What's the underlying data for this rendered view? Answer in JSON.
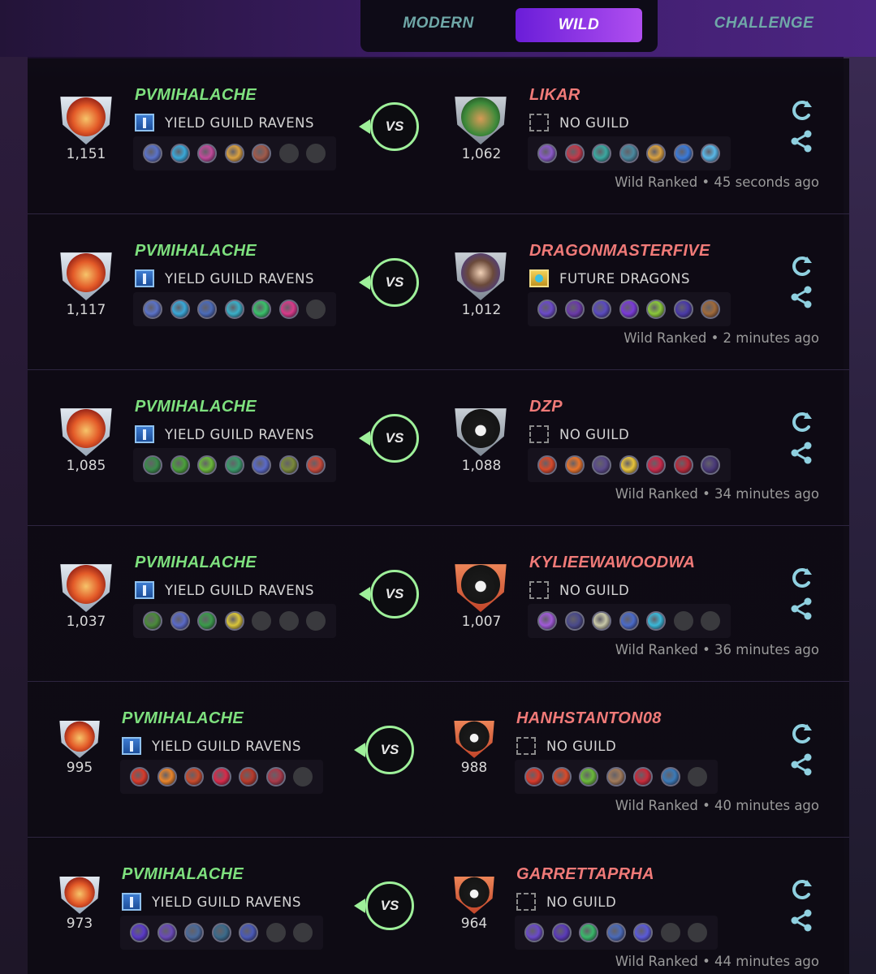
{
  "tabs": [
    {
      "label": "MODERN",
      "active": false
    },
    {
      "label": "WILD",
      "active": true
    },
    {
      "label": "CHALLENGE",
      "active": false
    }
  ],
  "vs_label": "VS",
  "colors": {
    "accent": "#9ef09a",
    "tab_active_start": "#6a1dd8",
    "tab_active_end": "#b04ff0",
    "player1_name": "#7ee07e",
    "player2_name": "#f07a78"
  },
  "matches": [
    {
      "p1": {
        "name": "PVMIHALACHE",
        "guild": "YIELD GUILD RAVENS",
        "rating": "1,151",
        "cards": [
          "#5a72c8",
          "#3aa8d8",
          "#c04a9a",
          "#d8a040",
          "#a05a4a",
          "empty",
          "empty"
        ]
      },
      "p2": {
        "name": "LIKAR",
        "guild": "NO GUILD",
        "rating": "1,062",
        "cards": [
          "#8a5ac8",
          "#c03a4a",
          "#3aa8a0",
          "#4a8aa0",
          "#d8a040",
          "#3a7ad8",
          "#5ab8e8"
        ]
      },
      "meta": "Wild Ranked • 45 seconds ago"
    },
    {
      "p1": {
        "name": "PVMIHALACHE",
        "guild": "YIELD GUILD RAVENS",
        "rating": "1,117",
        "cards": [
          "#5a72c8",
          "#3aa8d8",
          "#4a6ab8",
          "#3ab0c8",
          "#3ac06a",
          "#d83a8a",
          "empty"
        ]
      },
      "p2": {
        "name": "DRAGONMASTERFIVE",
        "guild": "FUTURE DRAGONS",
        "rating": "1,012",
        "cards": [
          "#6a4ac8",
          "#6a3aa8",
          "#5a4ac0",
          "#7a3ad8",
          "#8ac83a",
          "#4a3aa8",
          "#a06a3a"
        ]
      },
      "meta": "Wild Ranked • 2 minutes ago"
    },
    {
      "p1": {
        "name": "PVMIHALACHE",
        "guild": "YIELD GUILD RAVENS",
        "rating": "1,085",
        "cards": [
          "#3a8a4a",
          "#4aa03a",
          "#6ab83a",
          "#3a9a6a",
          "#5a6ac8",
          "#7a8a3a",
          "#c84a3a"
        ]
      },
      "p2": {
        "name": "DZP",
        "guild": "NO GUILD",
        "rating": "1,088",
        "cards": [
          "#d84a2a",
          "#e8742a",
          "#5a4a8a",
          "#e8c43a",
          "#c82a4a",
          "#b82a3a",
          "#4a3a7a"
        ]
      },
      "meta": "Wild Ranked • 34 minutes ago"
    },
    {
      "p1": {
        "name": "PVMIHALACHE",
        "guild": "YIELD GUILD RAVENS",
        "rating": "1,037",
        "cards": [
          "#4a8a3a",
          "#5a6ac8",
          "#3a9a4a",
          "#d8c43a",
          "empty",
          "empty",
          "empty"
        ]
      },
      "p2": {
        "name": "KYLIEEWAWOODWA",
        "guild": "NO GUILD",
        "rating": "1,007",
        "cards": [
          "#a05ad8",
          "#4a4a8a",
          "#c8c8a8",
          "#4a6ac8",
          "#3ab8d8",
          "empty",
          "empty"
        ]
      },
      "meta": "Wild Ranked • 36 minutes ago"
    },
    {
      "p1": {
        "name": "PVMIHALACHE",
        "guild": "YIELD GUILD RAVENS",
        "rating": "995",
        "cards": [
          "#d83a2a",
          "#e8842a",
          "#c84a2a",
          "#d82a4a",
          "#b83a2a",
          "#a83a4a",
          "empty"
        ]
      },
      "p2": {
        "name": "HANHSTANTON08",
        "guild": "NO GUILD",
        "rating": "988",
        "cards": [
          "#d83a2a",
          "#d84a2a",
          "#6ab83a",
          "#a07a5a",
          "#c82a3a",
          "#3a7ab8",
          "empty"
        ]
      },
      "meta": "Wild Ranked • 40 minutes ago"
    },
    {
      "p1": {
        "name": "PVMIHALACHE",
        "guild": "YIELD GUILD RAVENS",
        "rating": "973",
        "cards": [
          "#5a3ac8",
          "#6a4ab8",
          "#4a6a9a",
          "#3a6a8a",
          "#4a5ab8",
          "empty",
          "empty"
        ]
      },
      "p2": {
        "name": "GARRETTAPRHA",
        "guild": "NO GUILD",
        "rating": "964",
        "cards": [
          "#6a4ac8",
          "#5a3ab8",
          "#3ab86a",
          "#4a6ab8",
          "#5a5ad8",
          "empty",
          "empty"
        ]
      },
      "meta": "Wild Ranked • 44 minutes ago"
    }
  ]
}
